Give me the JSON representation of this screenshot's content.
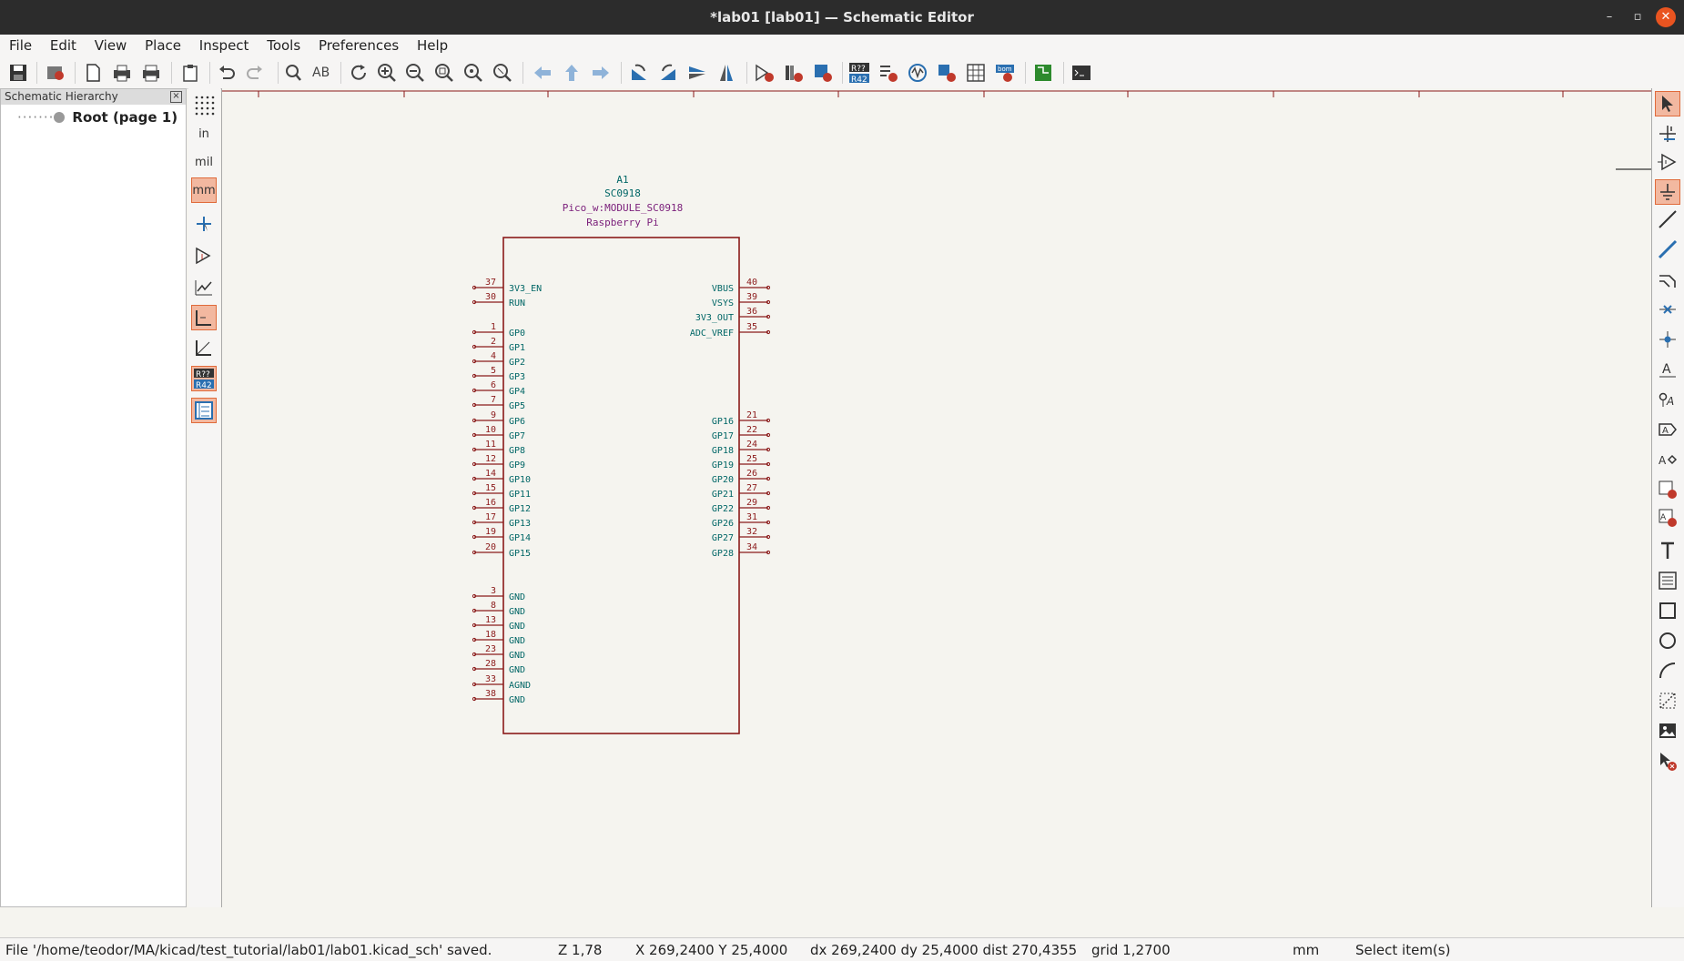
{
  "window": {
    "title": "*lab01 [lab01] — Schematic Editor",
    "min": "–",
    "max": "▫",
    "close": "✕"
  },
  "menu": [
    "File",
    "Edit",
    "View",
    "Place",
    "Inspect",
    "Tools",
    "Preferences",
    "Help"
  ],
  "hierarchy": {
    "title": "Schematic Hierarchy",
    "close": "×",
    "root": "Root (page 1)"
  },
  "units": {
    "in": "in",
    "mil": "mil",
    "mm": "mm",
    "annotate": "R?? R42"
  },
  "symbol": {
    "ref": "A1",
    "value": "SC0918",
    "footprint": "Pico_w:MODULE_SC0918",
    "manufacturer": "Raspberry Pi",
    "left_pins": [
      {
        "num": "37",
        "name": "3V3_EN"
      },
      {
        "num": "30",
        "name": "RUN"
      },
      {
        "num": "1",
        "name": "GP0"
      },
      {
        "num": "2",
        "name": "GP1"
      },
      {
        "num": "4",
        "name": "GP2"
      },
      {
        "num": "5",
        "name": "GP3"
      },
      {
        "num": "6",
        "name": "GP4"
      },
      {
        "num": "7",
        "name": "GP5"
      },
      {
        "num": "9",
        "name": "GP6"
      },
      {
        "num": "10",
        "name": "GP7"
      },
      {
        "num": "11",
        "name": "GP8"
      },
      {
        "num": "12",
        "name": "GP9"
      },
      {
        "num": "14",
        "name": "GP10"
      },
      {
        "num": "15",
        "name": "GP11"
      },
      {
        "num": "16",
        "name": "GP12"
      },
      {
        "num": "17",
        "name": "GP13"
      },
      {
        "num": "19",
        "name": "GP14"
      },
      {
        "num": "20",
        "name": "GP15"
      },
      {
        "num": "3",
        "name": "GND"
      },
      {
        "num": "8",
        "name": "GND"
      },
      {
        "num": "13",
        "name": "GND"
      },
      {
        "num": "18",
        "name": "GND"
      },
      {
        "num": "23",
        "name": "GND"
      },
      {
        "num": "28",
        "name": "GND"
      },
      {
        "num": "33",
        "name": "AGND"
      },
      {
        "num": "38",
        "name": "GND"
      }
    ],
    "right_pins": [
      {
        "num": "40",
        "name": "VBUS"
      },
      {
        "num": "39",
        "name": "VSYS"
      },
      {
        "num": "36",
        "name": "3V3_OUT"
      },
      {
        "num": "35",
        "name": "ADC_VREF"
      },
      {
        "num": "21",
        "name": "GP16"
      },
      {
        "num": "22",
        "name": "GP17"
      },
      {
        "num": "24",
        "name": "GP18"
      },
      {
        "num": "25",
        "name": "GP19"
      },
      {
        "num": "26",
        "name": "GP20"
      },
      {
        "num": "27",
        "name": "GP21"
      },
      {
        "num": "29",
        "name": "GP22"
      },
      {
        "num": "31",
        "name": "GP26"
      },
      {
        "num": "32",
        "name": "GP27"
      },
      {
        "num": "34",
        "name": "GP28"
      }
    ]
  },
  "status": {
    "message": "File '/home/teodor/MA/kicad/test_tutorial/lab01/lab01.kicad_sch' saved.",
    "zoom": "Z 1,78",
    "coords": "X 269,2400  Y 25,4000",
    "delta": "dx 269,2400  dy 25,4000  dist 270,4355",
    "grid": "grid 1,2700",
    "unit": "mm",
    "mode": "Select item(s)"
  },
  "colors": {
    "pin": "#8b1a1a",
    "pin_name": "#006666",
    "ref": "#006666",
    "footprint": "#7a1e7a",
    "body": "#8b1a1a",
    "accent": "#e06a3a"
  }
}
